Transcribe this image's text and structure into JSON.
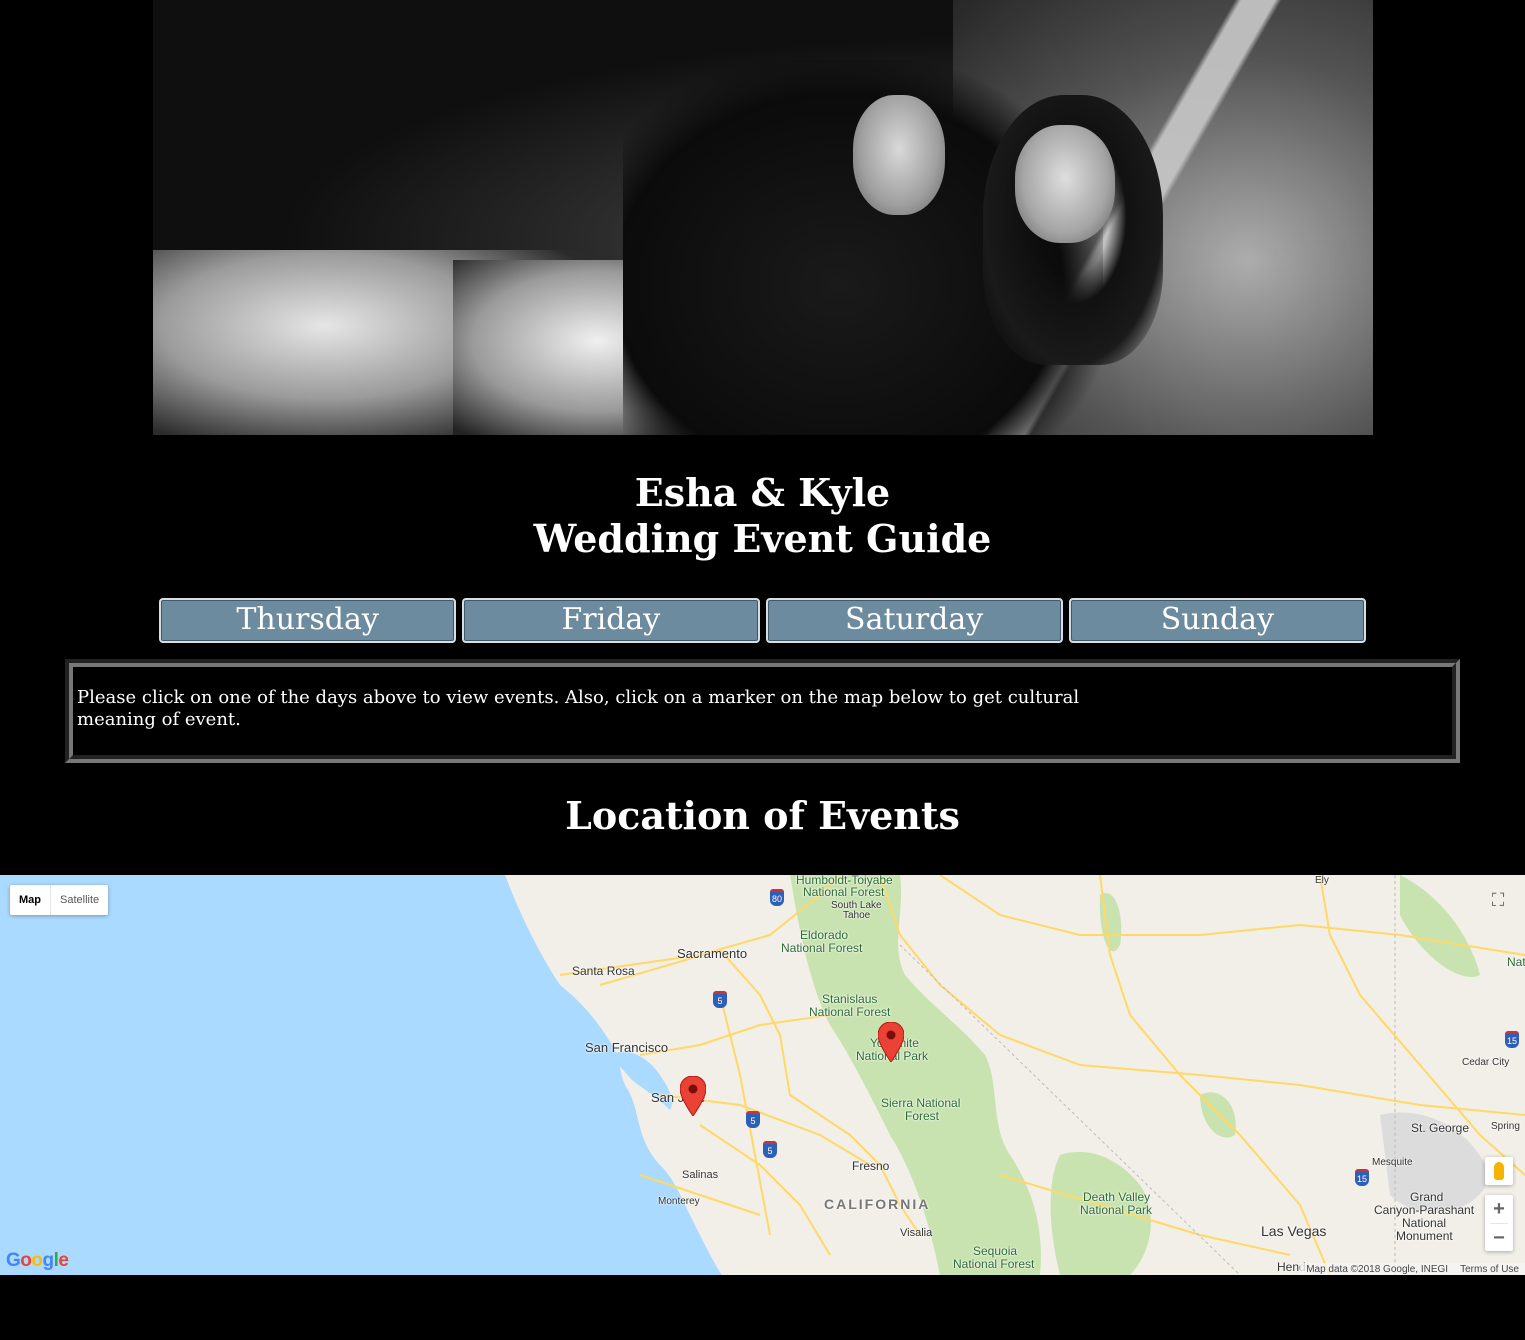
{
  "header": {
    "names": "Esha & Kyle",
    "subtitle": "Wedding Event Guide"
  },
  "days": [
    "Thursday",
    "Friday",
    "Saturday",
    "Sunday"
  ],
  "info": {
    "text": "Please click on one of the days above to view events. Also, click on a marker on the map below to get cultural meaning of event."
  },
  "section_title": "Location of Events",
  "map": {
    "type_buttons": [
      "Map",
      "Satellite"
    ],
    "active_type": "Map",
    "labels": {
      "humboldt": "Humboldt-Toiyabe",
      "humboldt2": "National Forest",
      "south_lake": "South Lake",
      "tahoe": "Tahoe",
      "eldorado": "Eldorado",
      "eldorado2": "National Forest",
      "sacramento": "Sacramento",
      "santa_rosa": "Santa Rosa",
      "stanislaus": "Stanislaus",
      "stanislaus2": "National Forest",
      "yosemite": "Yosemite",
      "yosemite2": "National Park",
      "san_francisco": "San Francisco",
      "san_jose": "San Jose",
      "sierra": "Sierra National",
      "sierra2": "Forest",
      "fresno": "Fresno",
      "salinas": "Salinas",
      "monterey": "Monterey",
      "california": "CALIFORNIA",
      "visalia": "Visalia",
      "death_valley": "Death Valley",
      "death_valley2": "National Park",
      "sequoia": "Sequoia",
      "sequoia2": "National Forest",
      "las_vegas": "Las Vegas",
      "henderson": "Hend",
      "st_george": "St. George",
      "mesquite": "Mesquite",
      "grand_canyon1": "Grand",
      "grand_canyon2": "Canyon-Parashant",
      "grand_canyon3": "National",
      "grand_canyon4": "Monument",
      "cedar_city": "Cedar City",
      "ely": "Ely",
      "nat": "Nat",
      "springdale": "Spring"
    },
    "shields": [
      "80",
      "5",
      "5",
      "5",
      "15",
      "15"
    ],
    "google_logo": [
      "G",
      "o",
      "o",
      "g",
      "l",
      "e"
    ],
    "attribution": "Map data ©2018 Google, INEGI",
    "terms": "Terms of Use",
    "water_color": "#aadaff",
    "land_color": "#f2efe8",
    "park_color": "#c8e3b0",
    "road_color": "#ffd866",
    "marker_color": "#ea4335"
  }
}
